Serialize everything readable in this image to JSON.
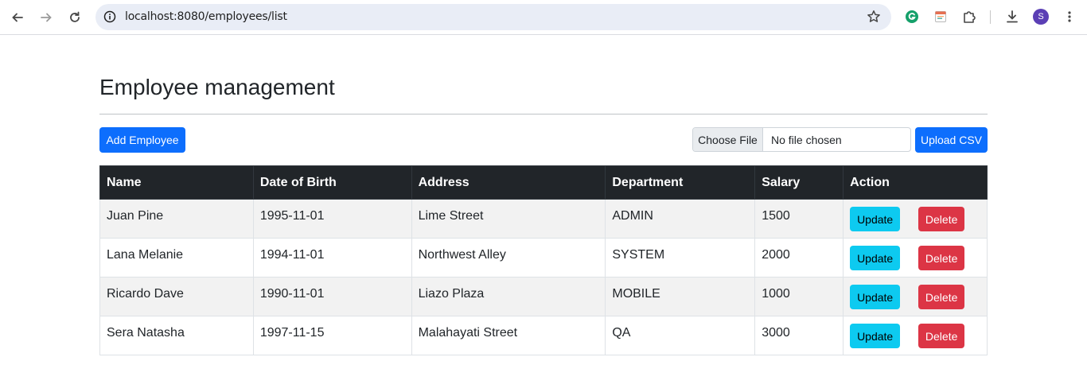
{
  "browser": {
    "url": "localhost:8080/employees/list",
    "avatar_letter": "S",
    "icons": [
      "back-arrow-icon",
      "forward-arrow-icon",
      "reload-icon",
      "info-icon",
      "star-icon",
      "grammarly-icon",
      "extension-note-icon",
      "puzzle-icon",
      "download-icon",
      "kebab-menu-icon"
    ]
  },
  "page": {
    "title": "Employee management",
    "add_button": "Add Employee",
    "file_choose": "Choose File",
    "file_status": "No file chosen",
    "upload_button": "Upload CSV"
  },
  "table": {
    "headers": [
      "Name",
      "Date of Birth",
      "Address",
      "Department",
      "Salary",
      "Action"
    ],
    "rows": [
      {
        "name": "Juan Pine",
        "dob": "1995-11-01",
        "address": "Lime Street",
        "department": "ADMIN",
        "salary": "1500"
      },
      {
        "name": "Lana Melanie",
        "dob": "1994-11-01",
        "address": "Northwest Alley",
        "department": "SYSTEM",
        "salary": "2000"
      },
      {
        "name": "Ricardo Dave",
        "dob": "1990-11-01",
        "address": "Liazo Plaza",
        "department": "MOBILE",
        "salary": "1000"
      },
      {
        "name": "Sera Natasha",
        "dob": "1997-11-15",
        "address": "Malahayati Street",
        "department": "QA",
        "salary": "3000"
      }
    ],
    "update_label": "Update",
    "delete_label": "Delete"
  },
  "colors": {
    "primary": "#0d6efd",
    "info": "#0dcaf0",
    "danger": "#dc3545",
    "table_header": "#212529",
    "avatar": "#5b3fb5"
  }
}
